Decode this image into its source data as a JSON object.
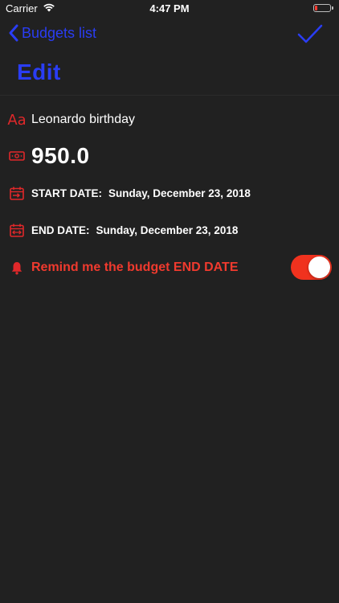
{
  "status_bar": {
    "carrier": "Carrier",
    "time": "4:47 PM",
    "battery_color": "#ff3b30"
  },
  "nav": {
    "back_label": "Budgets list",
    "back_icon": "chevron-left-icon",
    "confirm_icon": "checkmark-icon",
    "accent_color": "#2a3df4"
  },
  "page": {
    "title": "Edit"
  },
  "budget": {
    "name_icon_text": "Aa",
    "name": "Leonardo birthday",
    "amount_icon": "money-bill-icon",
    "amount": "950.0",
    "start_icon": "calendar-start-icon",
    "start_label": "START DATE:",
    "start_value": "Sunday, December 23, 2018",
    "end_icon": "calendar-end-icon",
    "end_label": "END DATE:",
    "end_value": "Sunday, December 23, 2018",
    "remind_icon": "bell-icon",
    "remind_label": "Remind me the budget END DATE",
    "remind_enabled": true,
    "accent_red": "#f03a2e"
  }
}
